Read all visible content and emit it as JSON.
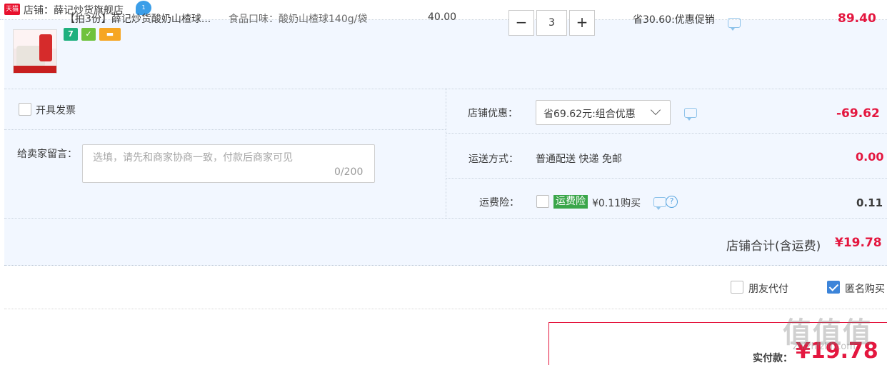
{
  "shop": {
    "badge": "天猫",
    "name": "店铺：薛记炒货旗舰店",
    "chat_badge": "1"
  },
  "item": {
    "title": "【拍3份】薛记炒货酸奶山楂球...",
    "sku": "食品口味：酸奶山楂球140g/袋",
    "badge_seven": "7",
    "unit_price": "40.00",
    "quantity": "3",
    "minus": "−",
    "plus": "+",
    "promo": "省30.60:优惠促销",
    "total": "89.40"
  },
  "options": {
    "invoice_label": "开具发票",
    "message_label": "给卖家留言：",
    "message_placeholder": "选填，请先和商家协商一致，付款后商家可见",
    "message_count": "0/200",
    "shop_promo_label": "店铺优惠：",
    "shop_promo_value": "省69.62元:组合优惠",
    "shop_discount": "-69.62",
    "shipping_label": "运送方式：",
    "shipping_value": "普通配送 快递 免邮",
    "shipping_cost": "0.00",
    "insurance_label": "运费险：",
    "insurance_tag": "运费险",
    "insurance_price": "¥0.11购买",
    "help": "?",
    "insurance_cost": "0.11",
    "shop_total_label": "店铺合计(含运费)",
    "shop_total_value": "¥19.78"
  },
  "footer": {
    "friend_pay_label": "朋友代付",
    "anonymous_label": "匿名购买",
    "pay_label": "实付款：",
    "pay_value": "¥19.78"
  },
  "watermark": {
    "text": "值值值",
    "site": "zhizhizhi.com"
  },
  "colors": {
    "accent_red": "#e4173f",
    "row_bg": "#f2f7ff",
    "checkbox_checked": "#3c84d9",
    "insurance_green": "#3aa64a"
  },
  "icons": [
    "tmall-icon",
    "wangwang-chat-icon",
    "message-icon",
    "help-icon",
    "chevron-down-icon",
    "checkmark-icon"
  ]
}
